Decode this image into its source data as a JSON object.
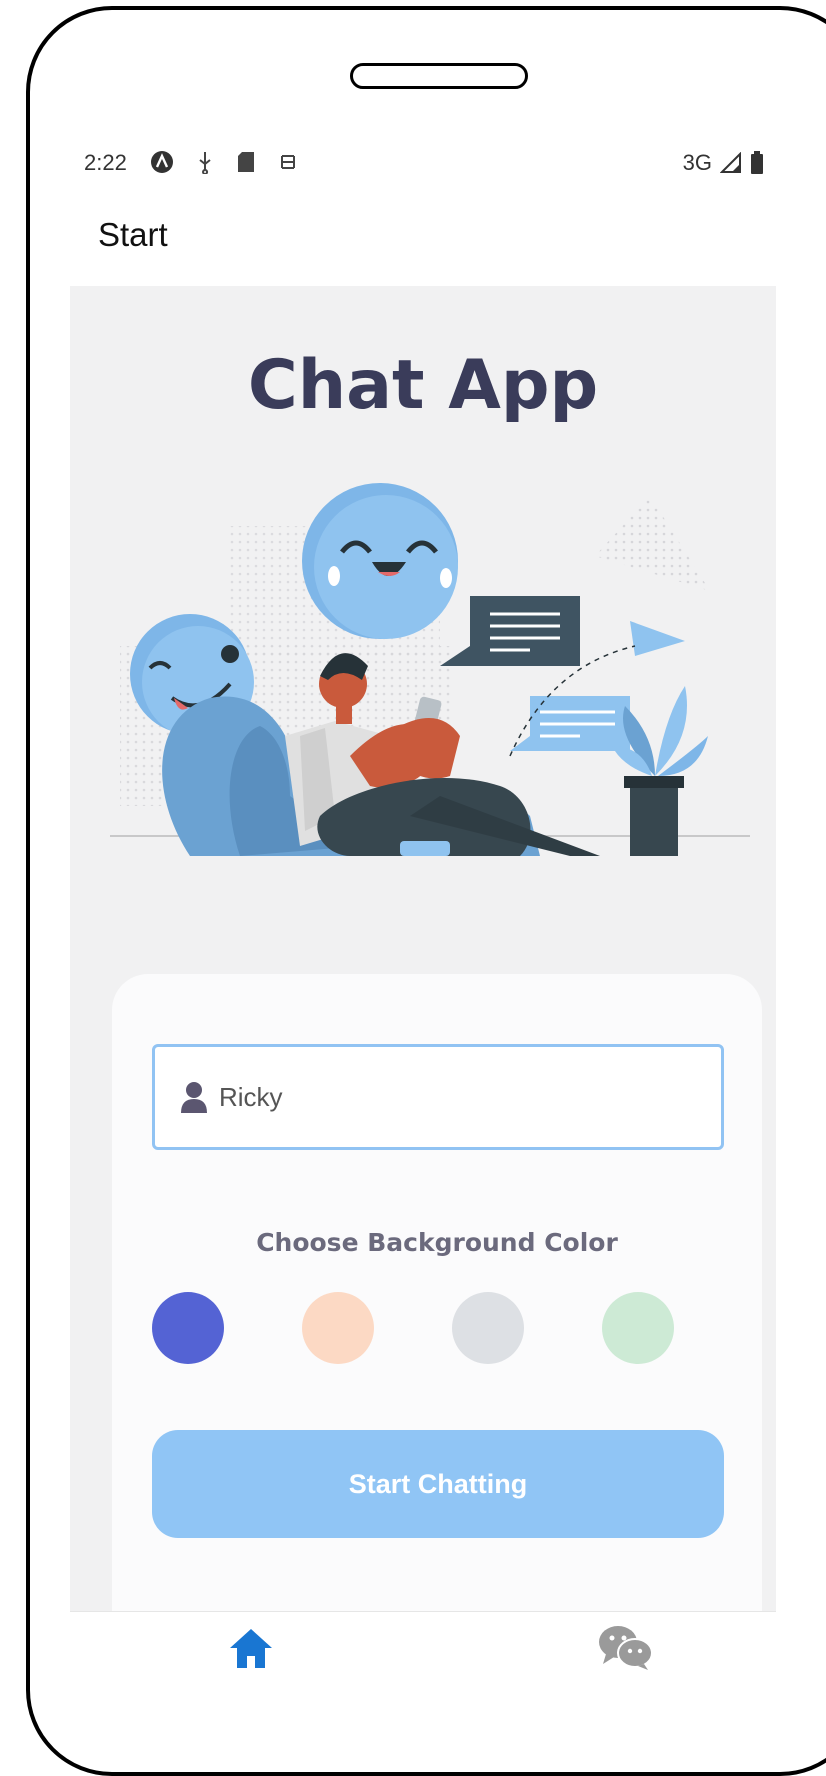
{
  "status_bar": {
    "time": "2:22",
    "left_icons": [
      "app-a-icon",
      "usb-icon",
      "sd-card-icon",
      "sync-icon"
    ],
    "network": "3G",
    "right_icons": [
      "signal-icon",
      "battery-icon"
    ]
  },
  "app_bar": {
    "title": "Start"
  },
  "hero": {
    "title": "Chat App"
  },
  "form": {
    "name_value": "Ricky",
    "name_icon": "user-icon",
    "choose_label": "Choose Background Color",
    "colors": [
      "#5463d4",
      "#fcd9c4",
      "#dde0e4",
      "#cdead5"
    ],
    "selected_color_index": 0,
    "start_button_label": "Start Chatting"
  },
  "bottom_nav": {
    "items": [
      "home-icon",
      "wechat-icon"
    ],
    "active_index": 0,
    "accent": "#1976d2"
  }
}
